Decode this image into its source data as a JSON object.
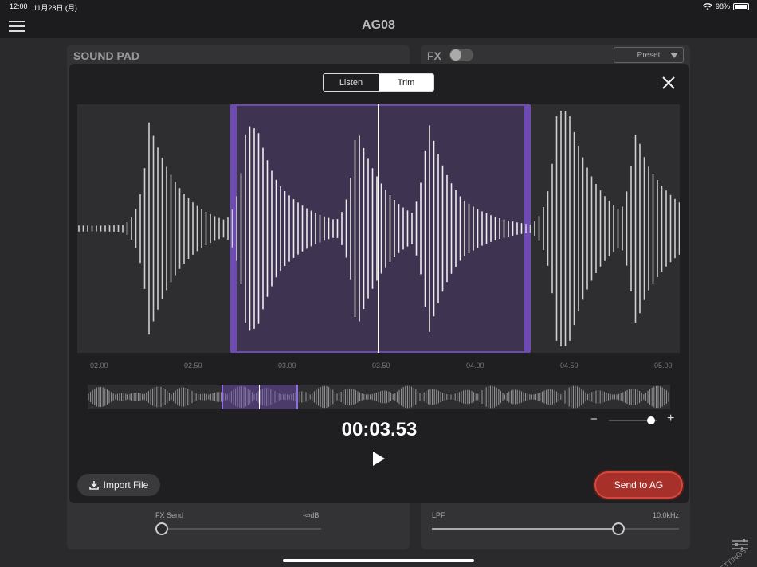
{
  "status": {
    "time": "12:00",
    "date": "11月28日 (月)",
    "battery": "98%"
  },
  "app": {
    "title": "AG08",
    "menu_icon": "hamburger-icon"
  },
  "sound_pad": {
    "title": "SOUND PAD",
    "fx_send": {
      "label": "FX Send",
      "value": "-∞dB",
      "level": 0.0
    }
  },
  "fx": {
    "title": "FX",
    "enabled": false,
    "preset_label": "Preset",
    "lpf": {
      "label": "LPF",
      "value": "10.0kHz",
      "level": 0.75
    }
  },
  "sound_settings_label": "SOUND SETTINGS",
  "editor": {
    "tabs": [
      {
        "label": "Listen",
        "active": false
      },
      {
        "label": "Trim",
        "active": true
      }
    ],
    "time_ticks": [
      "02.00",
      "02.50",
      "03.00",
      "03.50",
      "04.00",
      "04.50",
      "05.00"
    ],
    "timecode": "00:03.53",
    "import_label": "Import File",
    "send_label": "Send to AG",
    "colors": {
      "trim": "#6e4bb3",
      "send": "#a8302a"
    }
  }
}
